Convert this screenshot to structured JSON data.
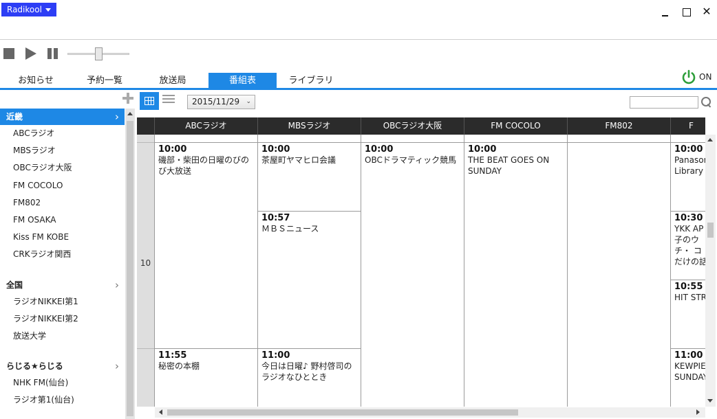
{
  "app_menu": {
    "label": "Radikool"
  },
  "window": {
    "minimize": "_",
    "maximize": "□",
    "close": "✕"
  },
  "tabs": [
    {
      "label": "お知らせ"
    },
    {
      "label": "予約一覧"
    },
    {
      "label": "放送局"
    },
    {
      "label": "番組表",
      "active": true
    },
    {
      "label": "ライブラリ"
    }
  ],
  "power": {
    "label": "ON",
    "color": "#2e9e3a"
  },
  "accent_color": "#1e88e5",
  "player": {
    "volume_level": 0.5
  },
  "sidebar": {
    "groups": [
      {
        "name": "近畿",
        "chevron": "›",
        "active": true,
        "stations": [
          "ABCラジオ",
          "MBSラジオ",
          "OBCラジオ大阪",
          "FM COCOLO",
          "FM802",
          "FM OSAKA",
          "Kiss FM KOBE",
          "CRKラジオ関西"
        ]
      },
      {
        "name": "全国",
        "chevron": "›",
        "active": false,
        "stations": [
          "ラジオNIKKEI第1",
          "ラジオNIKKEI第2",
          "放送大学"
        ]
      },
      {
        "name": "らじる★らじる",
        "chevron": "›",
        "active": false,
        "stations": [
          "NHK FM(仙台)",
          "ラジオ第1(仙台)"
        ]
      }
    ]
  },
  "toolbar": {
    "date": "2015/11/29",
    "date_dropdown": "⌄",
    "search_placeholder": ""
  },
  "grid": {
    "hour": "10",
    "columns": [
      {
        "name": "ABCラジオ",
        "programs": [
          {
            "time": "10:00",
            "title": "磯部・柴田の日曜のびのび大放送"
          },
          {
            "time": "11:55",
            "title": "秘密の本棚"
          }
        ]
      },
      {
        "name": "MBSラジオ",
        "programs": [
          {
            "time": "10:00",
            "title": "茶屋町ヤマヒロ会議"
          },
          {
            "time": "10:57",
            "title": "ＭＢＳニュース"
          },
          {
            "time": "11:00",
            "title": "今日は日曜♪ 野村啓司のラジオなひととき"
          }
        ]
      },
      {
        "name": "OBCラジオ大阪",
        "programs": [
          {
            "time": "10:00",
            "title": "OBCドラマティック競馬"
          }
        ]
      },
      {
        "name": "FM COCOLO",
        "programs": [
          {
            "time": "10:00",
            "title": "THE BEAT GOES ON SUNDAY"
          }
        ]
      },
      {
        "name": "FM802",
        "programs": []
      },
      {
        "name": "F",
        "programs": [
          {
            "time": "10:00",
            "title": "Panasor Library"
          },
          {
            "time": "10:30",
            "title": "YKK AP 子のウチ・ コだけの話"
          },
          {
            "time": "10:55",
            "title": "HIT STR"
          },
          {
            "time": "11:00",
            "title": "KEWPIE SUNDAY"
          }
        ]
      }
    ]
  }
}
